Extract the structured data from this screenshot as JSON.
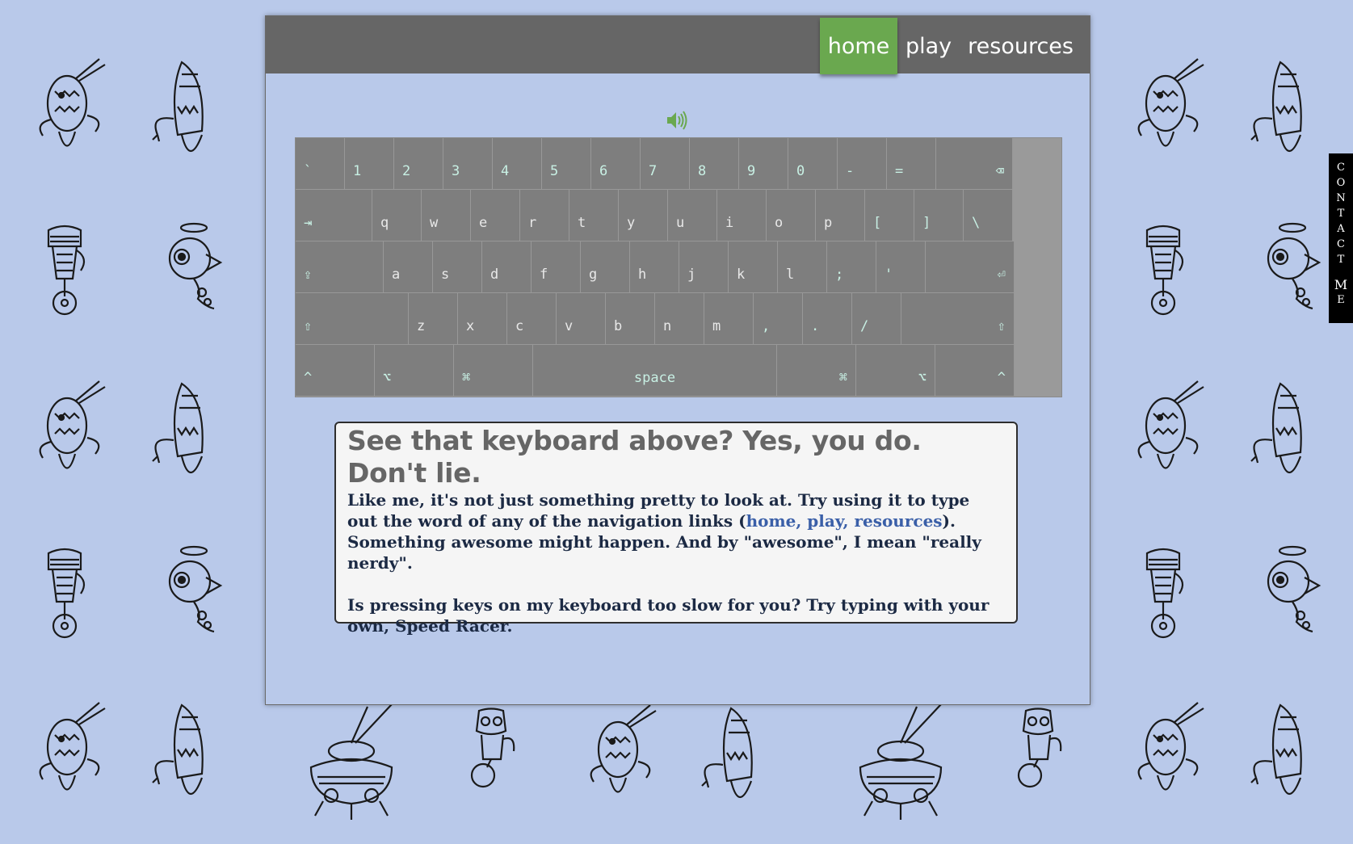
{
  "nav": {
    "items": [
      {
        "label": "home",
        "active": true
      },
      {
        "label": "play",
        "active": false
      },
      {
        "label": "resources",
        "active": false
      }
    ],
    "active_color": "#6aa84f"
  },
  "sound": {
    "icon": "speaker-icon",
    "color": "#6aa84f"
  },
  "keyboard": {
    "rows": [
      [
        {
          "label": "`",
          "w": 1
        },
        {
          "label": "1"
        },
        {
          "label": "2"
        },
        {
          "label": "3"
        },
        {
          "label": "4"
        },
        {
          "label": "5"
        },
        {
          "label": "6"
        },
        {
          "label": "7"
        },
        {
          "label": "8"
        },
        {
          "label": "9"
        },
        {
          "label": "0"
        },
        {
          "label": "-"
        },
        {
          "label": "="
        },
        {
          "label": "⌫",
          "align": "right"
        }
      ],
      [
        {
          "label": "⇥"
        },
        {
          "label": "q"
        },
        {
          "label": "w"
        },
        {
          "label": "e"
        },
        {
          "label": "r"
        },
        {
          "label": "t"
        },
        {
          "label": "y"
        },
        {
          "label": "u"
        },
        {
          "label": "i"
        },
        {
          "label": "o"
        },
        {
          "label": "p"
        },
        {
          "label": "["
        },
        {
          "label": "]"
        },
        {
          "label": "\\"
        }
      ],
      [
        {
          "label": "⇪"
        },
        {
          "label": "a"
        },
        {
          "label": "s"
        },
        {
          "label": "d"
        },
        {
          "label": "f"
        },
        {
          "label": "g"
        },
        {
          "label": "h"
        },
        {
          "label": "j"
        },
        {
          "label": "k"
        },
        {
          "label": "l"
        },
        {
          "label": ";"
        },
        {
          "label": "'"
        },
        {
          "label": "⏎",
          "align": "right"
        }
      ],
      [
        {
          "label": "⇧"
        },
        {
          "label": "z"
        },
        {
          "label": "x"
        },
        {
          "label": "c"
        },
        {
          "label": "v"
        },
        {
          "label": "b"
        },
        {
          "label": "n"
        },
        {
          "label": "m"
        },
        {
          "label": ","
        },
        {
          "label": "."
        },
        {
          "label": "/"
        },
        {
          "label": "⇧",
          "align": "right"
        }
      ],
      [
        {
          "label": "^"
        },
        {
          "label": "⌥"
        },
        {
          "label": "⌘"
        },
        {
          "label": "space",
          "align": "center"
        },
        {
          "label": "⌘",
          "align": "right"
        },
        {
          "label": "⌥",
          "align": "right"
        },
        {
          "label": "^",
          "align": "right"
        }
      ]
    ]
  },
  "intro": {
    "heading": "See that keyboard above? Yes, you do. Don't lie.",
    "p1_before": "Like me, it's not just something pretty to look at. Try using it to type out the word of any of the navigation links (",
    "p1_link": "home, play, resources",
    "p1_after": "). Something awesome might happen. And by \"awesome\", I mean \"really nerdy\".",
    "p2": "Is pressing keys on my keyboard too slow for you? Try typing with your own, Speed Racer."
  },
  "contact": {
    "letters": [
      "C",
      "O",
      "N",
      "T",
      "A",
      "C",
      "T"
    ],
    "letters2": [
      "M",
      "E"
    ]
  }
}
